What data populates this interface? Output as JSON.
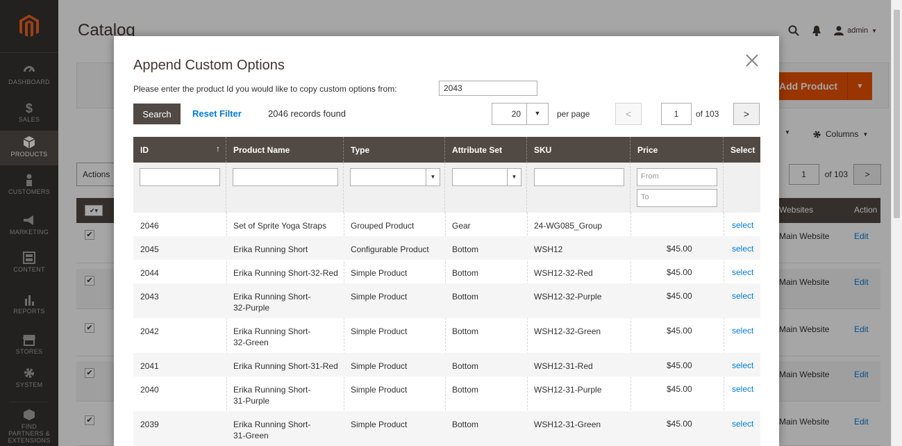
{
  "sidebar": {
    "logo": "magento-logo",
    "items": [
      {
        "label": "DASHBOARD",
        "icon": "dashboard-icon"
      },
      {
        "label": "SALES",
        "icon": "dollar-icon"
      },
      {
        "label": "PRODUCTS",
        "icon": "cube-icon"
      },
      {
        "label": "CUSTOMERS",
        "icon": "person-icon"
      },
      {
        "label": "MARKETING",
        "icon": "megaphone-icon"
      },
      {
        "label": "CONTENT",
        "icon": "layout-icon"
      },
      {
        "label": "REPORTS",
        "icon": "bar-chart-icon"
      },
      {
        "label": "STORES",
        "icon": "store-icon"
      },
      {
        "label": "SYSTEM",
        "icon": "gear-icon"
      },
      {
        "label": "FIND PARTNERS & EXTENSIONS",
        "icon": "box-icon"
      }
    ]
  },
  "background": {
    "page_title": "Catalog",
    "user": "admin",
    "add_product": "Add Product",
    "columns_label": "Columns",
    "actions_label": "Actions",
    "pager_page": "1",
    "pager_of": "of 103",
    "websites_header": "Websites",
    "action_header": "Action",
    "row_website": "Main Website",
    "row_edit": "Edit"
  },
  "modal": {
    "title": "Append Custom Options",
    "prompt": "Please enter the product Id you would like to copy custom options from:",
    "product_id_value": "2043",
    "search_button": "Search",
    "reset_filter": "Reset Filter",
    "records_found": "2046 records found",
    "per_page_value": "20",
    "per_page_label": "per page",
    "current_page": "1",
    "page_of": "of 103",
    "filter_from_placeholder": "From",
    "filter_to_placeholder": "To"
  },
  "grid": {
    "headers": [
      "ID",
      "Product Name",
      "Type",
      "Attribute Set",
      "SKU",
      "Price",
      "Select"
    ],
    "rows": [
      {
        "id": "2046",
        "name": "Set of Sprite Yoga Straps",
        "type": "Grouped Product",
        "attr": "Gear",
        "sku": "24-WG085_Group",
        "price": "",
        "select": "select"
      },
      {
        "id": "2045",
        "name": "Erika Running Short",
        "type": "Configurable Product",
        "attr": "Bottom",
        "sku": "WSH12",
        "price": "$45.00",
        "select": "select"
      },
      {
        "id": "2044",
        "name": "Erika Running Short-32-Red",
        "type": "Simple Product",
        "attr": "Bottom",
        "sku": "WSH12-32-Red",
        "price": "$45.00",
        "select": "select"
      },
      {
        "id": "2043",
        "name": "Erika Running Short-32-Purple",
        "name_l1": "Erika Running Short-",
        "name_l2": "32-Purple",
        "type": "Simple Product",
        "attr": "Bottom",
        "sku": "WSH12-32-Purple",
        "price": "$45.00",
        "select": "select"
      },
      {
        "id": "2042",
        "name": "Erika Running Short-32-Green",
        "name_l1": "Erika Running Short-",
        "name_l2": "32-Green",
        "type": "Simple Product",
        "attr": "Bottom",
        "sku": "WSH12-32-Green",
        "price": "$45.00",
        "select": "select"
      },
      {
        "id": "2041",
        "name": "Erika Running Short-31-Red",
        "type": "Simple Product",
        "attr": "Bottom",
        "sku": "WSH12-31-Red",
        "price": "$45.00",
        "select": "select"
      },
      {
        "id": "2040",
        "name": "Erika Running Short-31-Purple",
        "name_l1": "Erika Running Short-",
        "name_l2": "31-Purple",
        "type": "Simple Product",
        "attr": "Bottom",
        "sku": "WSH12-31-Purple",
        "price": "$45.00",
        "select": "select"
      },
      {
        "id": "2039",
        "name": "Erika Running Short-31-Green",
        "name_l1": "Erika Running Short-",
        "name_l2": "31-Green",
        "type": "Simple Product",
        "attr": "Bottom",
        "sku": "WSH12-31-Green",
        "price": "$45.00",
        "select": "select"
      }
    ]
  },
  "colors": {
    "sidebar_bg": "#373330",
    "header_bg": "#514943",
    "accent_orange": "#eb5202",
    "link_blue": "#007bdb"
  }
}
